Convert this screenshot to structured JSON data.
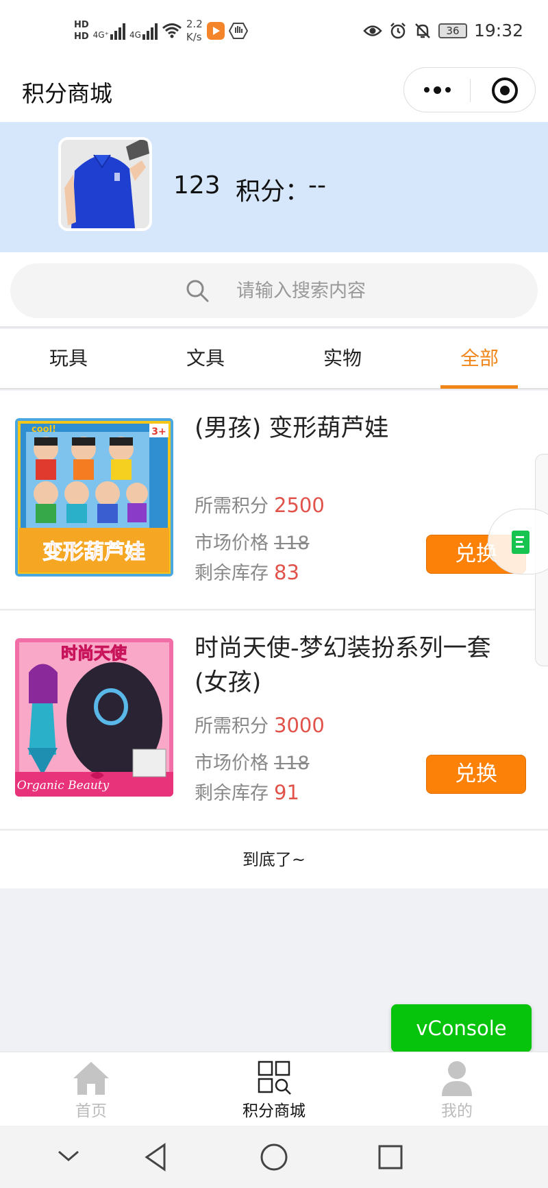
{
  "status_bar": {
    "hd1": "HD",
    "hd2": "HD",
    "net1": "4G⁺",
    "net2": "4G",
    "speed_value": "2.2",
    "speed_unit": "K/s",
    "battery": "36",
    "time": "19:32"
  },
  "nav": {
    "title": "积分商城"
  },
  "profile": {
    "username": "123",
    "points_label": "积分：",
    "points_value": "--"
  },
  "search": {
    "placeholder": "请输入搜索内容"
  },
  "tabs": [
    {
      "label": "玩具",
      "active": false
    },
    {
      "label": "文具",
      "active": false
    },
    {
      "label": "实物",
      "active": false
    },
    {
      "label": "全部",
      "active": true
    }
  ],
  "products": [
    {
      "title": "(男孩) 变形葫芦娃",
      "points_label": "所需积分",
      "points": "2500",
      "price_label": "市场价格",
      "price": "118",
      "stock_label": "剩余库存",
      "stock": "83",
      "button": "兑换",
      "image_text": "变形葫芦娃"
    },
    {
      "title": "时尚天使-梦幻装扮系列一套(女孩)",
      "points_label": "所需积分",
      "points": "3000",
      "price_label": "市场价格",
      "price": "118",
      "stock_label": "剩余库存",
      "stock": "91",
      "button": "兑换",
      "image_text": "Organic Beauty"
    }
  ],
  "end_text": "到底了~",
  "vconsole": "vConsole",
  "tabbar": [
    {
      "label": "首页",
      "icon": "home-icon",
      "active": false
    },
    {
      "label": "积分商城",
      "icon": "apps-search-icon",
      "active": true
    },
    {
      "label": "我的",
      "icon": "person-icon",
      "active": false
    }
  ],
  "colors": {
    "accent": "#f08519",
    "button": "#fb8109",
    "price_red": "#e0524a",
    "profile_bg": "#d6e6fb",
    "vconsole_green": "#06c30b"
  }
}
